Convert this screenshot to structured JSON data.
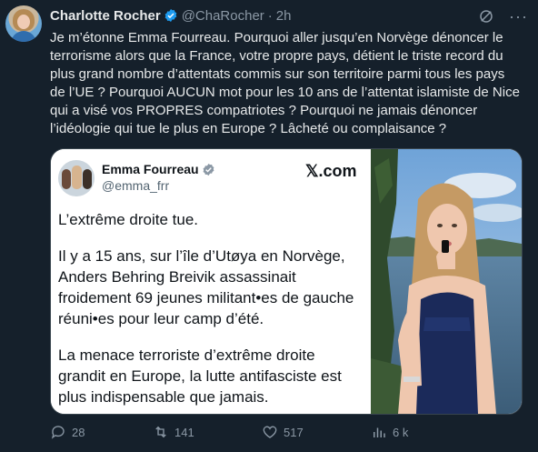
{
  "tweet": {
    "author_name": "Charlotte Rocher",
    "author_handle": "@ChaRocher",
    "separator": "·",
    "time": "2h",
    "text": "Je m’étonne Emma Fourreau. Pourquoi aller jusqu’en Norvège dénoncer le terrorisme alors que la France, votre propre pays, détient le triste record du plus grand nombre d’attentats commis sur son territoire parmi tous les pays de l’UE ? Pourquoi AUCUN mot pour les 10 ans de l’attentat islamiste de Nice qui a visé vos PROPRES compatriotes ? Pourquoi ne jamais dénoncer l’idéologie qui tue le plus en Europe ? Lâcheté ou complaisance ?"
  },
  "quoted_card": {
    "author_name": "Emma Fourreau",
    "author_handle": "@emma_frr",
    "source": "𝕏.com",
    "paragraphs": [
      "L’extrême droite tue.",
      "Il y a 15 ans, sur l’île d’Utøya en Norvège, Anders Behring Breivik assassinait froidement 69 jeunes militant•es de gauche réuni•es pour leur camp d’été.",
      "La menace terroriste d’extrême droite grandit en Europe, la lutte antifasciste est plus indispensable que jamais."
    ]
  },
  "actions": {
    "replies": "28",
    "reposts": "141",
    "likes": "517",
    "views": "6 k"
  },
  "colors": {
    "background": "#15202b",
    "text": "#e7e9ea",
    "muted": "#8b98a5",
    "verified": "#1d9bf0"
  },
  "icons": {
    "verified": "verified-badge-icon",
    "grok": "grok-icon",
    "more": "more-icon",
    "reply": "reply-icon",
    "repost": "repost-icon",
    "like": "like-icon",
    "views": "views-icon"
  }
}
